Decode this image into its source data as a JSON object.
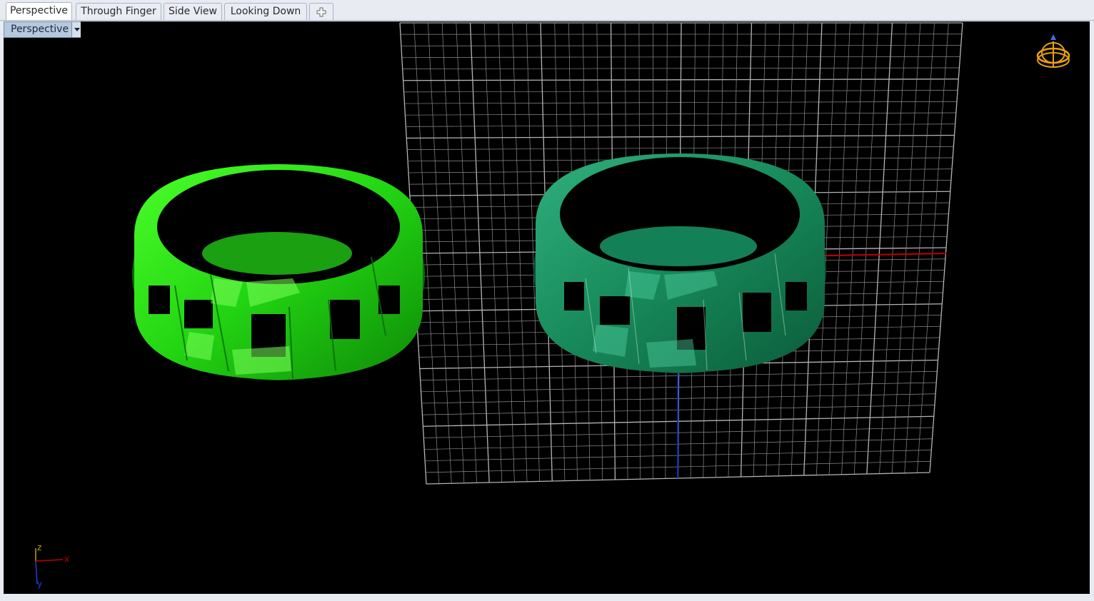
{
  "tabs": [
    {
      "label": "Perspective",
      "active": true
    },
    {
      "label": "Through Finger",
      "active": false
    },
    {
      "label": "Side View",
      "active": false
    },
    {
      "label": "Looking Down",
      "active": false
    }
  ],
  "add_tab_icon": "plus-icon",
  "viewport": {
    "label": "Perspective",
    "dropdown_icon": "chevron-down-icon",
    "navigation_icon": "orbit-gumball-icon"
  },
  "axes_indicator": {
    "z": "z",
    "x": "x",
    "y": "y"
  },
  "colors": {
    "background": "#000000",
    "grid": "#8c8c8c",
    "x_axis": "#c00000",
    "y_axis": "#1030c0",
    "ring_left": "#22dd10",
    "ring_right": "#1a9a66",
    "label_bg": "#b6c8de"
  }
}
